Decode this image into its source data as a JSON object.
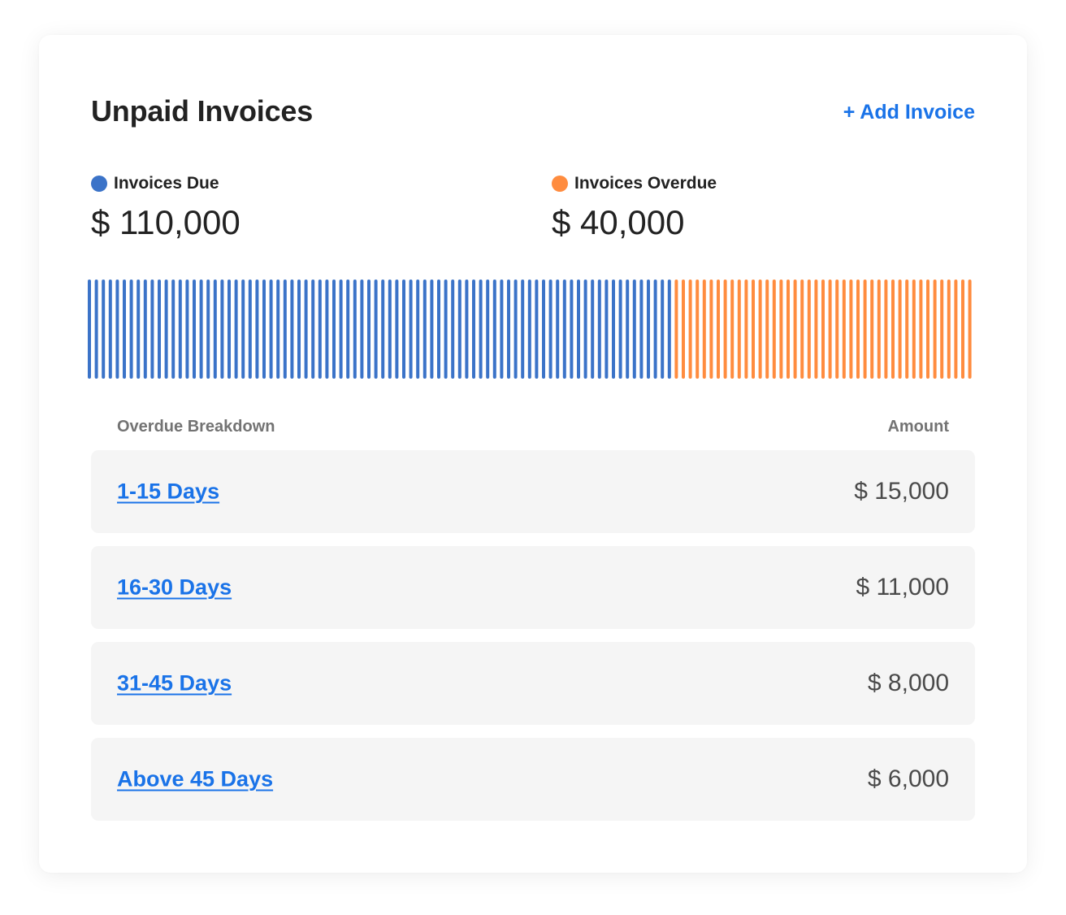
{
  "header": {
    "title": "Unpaid Invoices",
    "add_label": "+ Add Invoice"
  },
  "summary": {
    "due": {
      "label": "Invoices Due",
      "value": "$ 110,000",
      "amount": 110000,
      "color": "#3b73c8"
    },
    "overdue": {
      "label": "Invoices Overdue",
      "value": "$ 40,000",
      "amount": 40000,
      "color": "#ff8c3f"
    }
  },
  "progress": {
    "due_fraction": 0.6608,
    "due_color": "#3b73c8",
    "overdue_color": "#ff8c3f"
  },
  "breakdown": {
    "col_left": "Overdue Breakdown",
    "col_right": "Amount",
    "rows": [
      {
        "label": "1-15 Days",
        "amount": "$ 15,000"
      },
      {
        "label": "16-30 Days",
        "amount": "$ 11,000"
      },
      {
        "label": "31-45 Days",
        "amount": "$ 8,000"
      },
      {
        "label": "Above 45 Days",
        "amount": "$ 6,000"
      }
    ]
  }
}
